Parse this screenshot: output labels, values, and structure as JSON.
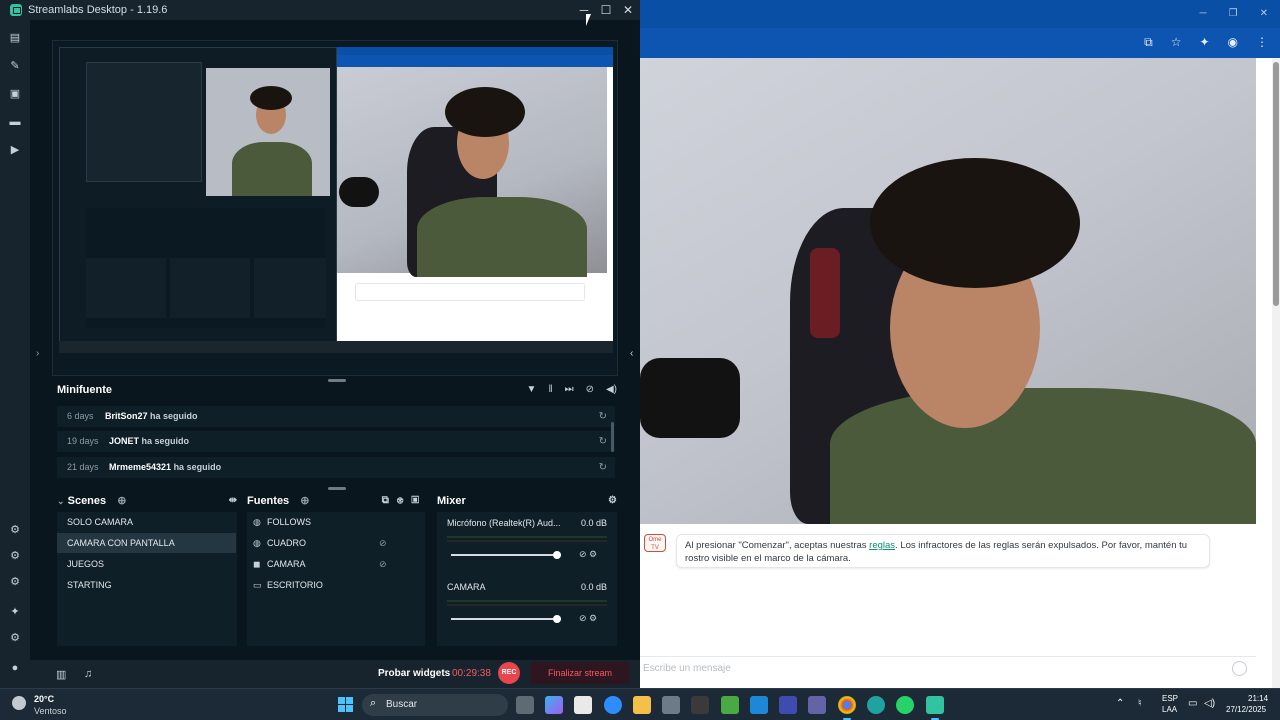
{
  "window": {
    "title": "Streamlabs Desktop - 1.19.6",
    "min": "─",
    "max": "☐",
    "close": "✕"
  },
  "nav_icons": [
    "editor-icon",
    "themes-icon",
    "store-icon",
    "layout-icon",
    "play-icon"
  ],
  "minifuente": {
    "title": "Minifuente",
    "events": [
      {
        "days": "6 days",
        "who": "BritSon27",
        "action": "ha seguido"
      },
      {
        "days": "19 days",
        "who": "JONET",
        "action": "ha seguido"
      },
      {
        "days": "21 days",
        "who": "Mrmeme54321",
        "action": "ha seguido"
      }
    ]
  },
  "scenes": {
    "title": "Scenes",
    "items": [
      "SOLO CAMARA",
      "CAMARA CON PANTALLA",
      "JUEGOS",
      "STARTING"
    ],
    "active_index": 1
  },
  "sources": {
    "title": "Fuentes",
    "items": [
      "FOLLOWS",
      "CUADRO",
      "CAMARA",
      "ESCRITORIO"
    ]
  },
  "mixer": {
    "title": "Mixer",
    "channels": [
      {
        "name": "Micrófono (Realtek(R) Aud...",
        "db": "0.0 dB",
        "level": 0.96
      },
      {
        "name": "CAMARA",
        "db": "0.0 dB",
        "level": 0.96
      }
    ]
  },
  "footer": {
    "probar": "Probar widgets",
    "timer": "00:29:38",
    "rec": "REC",
    "end_stream": "Finalizar stream"
  },
  "chat": {
    "logo": "Ome TV",
    "notice_pre": "Al presionar \"Comenzar\", aceptas nuestras ",
    "notice_link": "reglas",
    "notice_post": ". Los infractores de las reglas serán expulsados. Por favor, mantén tu rostro visible en el marco de la cámara.",
    "placeholder": "Escribe un mensaje"
  },
  "taskbar": {
    "temp": "20°C",
    "weather": "Ventoso",
    "search": "Buscar",
    "lang1": "ESP",
    "lang2": "LAA",
    "time": "21:14",
    "date": "27/12/2025"
  },
  "colors": {
    "accent": "#31c3a2",
    "rec": "#e8454c",
    "browser_bar": "#0d55b0"
  }
}
